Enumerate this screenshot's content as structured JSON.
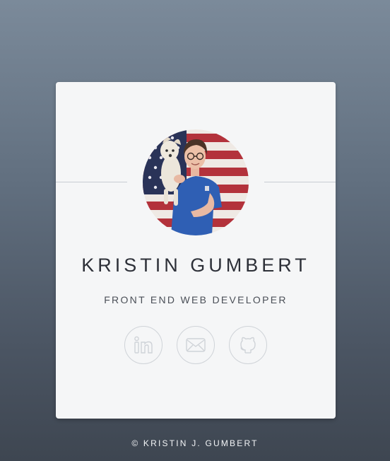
{
  "profile": {
    "name": "KRISTIN GUMBERT",
    "title": "FRONT END WEB DEVELOPER",
    "photo_alt": "Kristin Gumbert holding a dog in front of an American flag"
  },
  "social_links": [
    {
      "name": "linkedin",
      "icon": "linkedin-icon"
    },
    {
      "name": "email",
      "icon": "envelope-icon"
    },
    {
      "name": "github",
      "icon": "github-icon"
    }
  ],
  "footer": {
    "copyright": "© KRISTIN J. GUMBERT"
  },
  "colors": {
    "background_top": "#7b8a9a",
    "background_bottom": "#3e4651",
    "card": "#f5f6f7",
    "icon_line": "#cfd3d8",
    "text_dark": "#2d3038"
  }
}
